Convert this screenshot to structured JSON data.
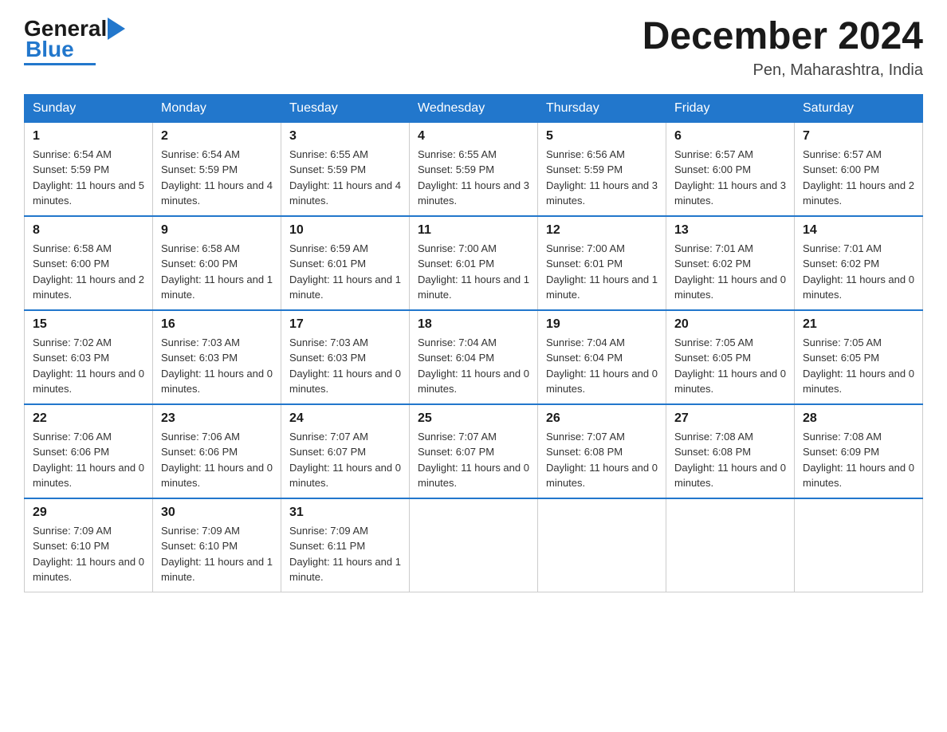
{
  "header": {
    "logo_general": "General",
    "logo_blue": "Blue",
    "month_title": "December 2024",
    "location": "Pen, Maharashtra, India"
  },
  "days_of_week": [
    "Sunday",
    "Monday",
    "Tuesday",
    "Wednesday",
    "Thursday",
    "Friday",
    "Saturday"
  ],
  "weeks": [
    [
      {
        "day": "1",
        "sunrise": "6:54 AM",
        "sunset": "5:59 PM",
        "daylight": "11 hours and 5 minutes."
      },
      {
        "day": "2",
        "sunrise": "6:54 AM",
        "sunset": "5:59 PM",
        "daylight": "11 hours and 4 minutes."
      },
      {
        "day": "3",
        "sunrise": "6:55 AM",
        "sunset": "5:59 PM",
        "daylight": "11 hours and 4 minutes."
      },
      {
        "day": "4",
        "sunrise": "6:55 AM",
        "sunset": "5:59 PM",
        "daylight": "11 hours and 3 minutes."
      },
      {
        "day": "5",
        "sunrise": "6:56 AM",
        "sunset": "5:59 PM",
        "daylight": "11 hours and 3 minutes."
      },
      {
        "day": "6",
        "sunrise": "6:57 AM",
        "sunset": "6:00 PM",
        "daylight": "11 hours and 3 minutes."
      },
      {
        "day": "7",
        "sunrise": "6:57 AM",
        "sunset": "6:00 PM",
        "daylight": "11 hours and 2 minutes."
      }
    ],
    [
      {
        "day": "8",
        "sunrise": "6:58 AM",
        "sunset": "6:00 PM",
        "daylight": "11 hours and 2 minutes."
      },
      {
        "day": "9",
        "sunrise": "6:58 AM",
        "sunset": "6:00 PM",
        "daylight": "11 hours and 1 minute."
      },
      {
        "day": "10",
        "sunrise": "6:59 AM",
        "sunset": "6:01 PM",
        "daylight": "11 hours and 1 minute."
      },
      {
        "day": "11",
        "sunrise": "7:00 AM",
        "sunset": "6:01 PM",
        "daylight": "11 hours and 1 minute."
      },
      {
        "day": "12",
        "sunrise": "7:00 AM",
        "sunset": "6:01 PM",
        "daylight": "11 hours and 1 minute."
      },
      {
        "day": "13",
        "sunrise": "7:01 AM",
        "sunset": "6:02 PM",
        "daylight": "11 hours and 0 minutes."
      },
      {
        "day": "14",
        "sunrise": "7:01 AM",
        "sunset": "6:02 PM",
        "daylight": "11 hours and 0 minutes."
      }
    ],
    [
      {
        "day": "15",
        "sunrise": "7:02 AM",
        "sunset": "6:03 PM",
        "daylight": "11 hours and 0 minutes."
      },
      {
        "day": "16",
        "sunrise": "7:03 AM",
        "sunset": "6:03 PM",
        "daylight": "11 hours and 0 minutes."
      },
      {
        "day": "17",
        "sunrise": "7:03 AM",
        "sunset": "6:03 PM",
        "daylight": "11 hours and 0 minutes."
      },
      {
        "day": "18",
        "sunrise": "7:04 AM",
        "sunset": "6:04 PM",
        "daylight": "11 hours and 0 minutes."
      },
      {
        "day": "19",
        "sunrise": "7:04 AM",
        "sunset": "6:04 PM",
        "daylight": "11 hours and 0 minutes."
      },
      {
        "day": "20",
        "sunrise": "7:05 AM",
        "sunset": "6:05 PM",
        "daylight": "11 hours and 0 minutes."
      },
      {
        "day": "21",
        "sunrise": "7:05 AM",
        "sunset": "6:05 PM",
        "daylight": "11 hours and 0 minutes."
      }
    ],
    [
      {
        "day": "22",
        "sunrise": "7:06 AM",
        "sunset": "6:06 PM",
        "daylight": "11 hours and 0 minutes."
      },
      {
        "day": "23",
        "sunrise": "7:06 AM",
        "sunset": "6:06 PM",
        "daylight": "11 hours and 0 minutes."
      },
      {
        "day": "24",
        "sunrise": "7:07 AM",
        "sunset": "6:07 PM",
        "daylight": "11 hours and 0 minutes."
      },
      {
        "day": "25",
        "sunrise": "7:07 AM",
        "sunset": "6:07 PM",
        "daylight": "11 hours and 0 minutes."
      },
      {
        "day": "26",
        "sunrise": "7:07 AM",
        "sunset": "6:08 PM",
        "daylight": "11 hours and 0 minutes."
      },
      {
        "day": "27",
        "sunrise": "7:08 AM",
        "sunset": "6:08 PM",
        "daylight": "11 hours and 0 minutes."
      },
      {
        "day": "28",
        "sunrise": "7:08 AM",
        "sunset": "6:09 PM",
        "daylight": "11 hours and 0 minutes."
      }
    ],
    [
      {
        "day": "29",
        "sunrise": "7:09 AM",
        "sunset": "6:10 PM",
        "daylight": "11 hours and 0 minutes."
      },
      {
        "day": "30",
        "sunrise": "7:09 AM",
        "sunset": "6:10 PM",
        "daylight": "11 hours and 1 minute."
      },
      {
        "day": "31",
        "sunrise": "7:09 AM",
        "sunset": "6:11 PM",
        "daylight": "11 hours and 1 minute."
      },
      null,
      null,
      null,
      null
    ]
  ],
  "labels": {
    "sunrise": "Sunrise:",
    "sunset": "Sunset:",
    "daylight": "Daylight:"
  }
}
